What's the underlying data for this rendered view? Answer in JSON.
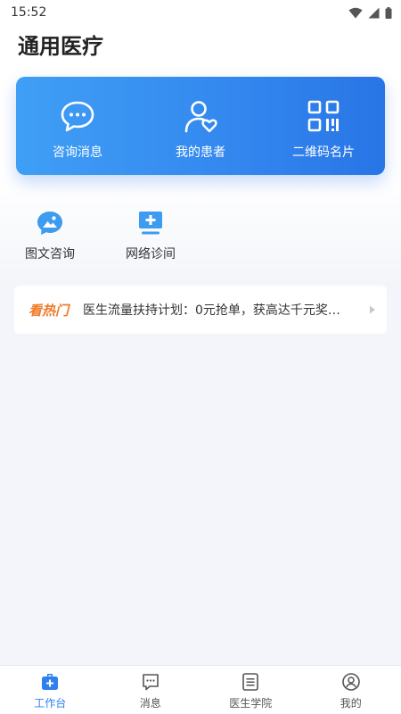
{
  "status_bar": {
    "time": "15:52"
  },
  "app": {
    "title": "通用医疗"
  },
  "quick_actions": [
    {
      "label": "咨询消息",
      "icon": "chat-bubble-icon"
    },
    {
      "label": "我的患者",
      "icon": "patient-heart-icon"
    },
    {
      "label": "二维码名片",
      "icon": "qr-code-icon"
    }
  ],
  "services": [
    {
      "label": "图文咨询",
      "icon": "image-chat-icon"
    },
    {
      "label": "网络诊间",
      "icon": "monitor-plus-icon"
    }
  ],
  "hot": {
    "tag": "看热门",
    "text": "医生流量扶持计划：0元抢单，获高达千元奖…"
  },
  "tabs": [
    {
      "label": "工作台",
      "icon": "medical-bag-icon",
      "active": true
    },
    {
      "label": "消息",
      "icon": "message-icon",
      "active": false
    },
    {
      "label": "医生学院",
      "icon": "document-list-icon",
      "active": false
    },
    {
      "label": "我的",
      "icon": "user-circle-icon",
      "active": false
    }
  ],
  "colors": {
    "accent": "#2f80ed",
    "card_gradient_start": "#3f9ff5",
    "card_gradient_end": "#2875e6",
    "hot_tag": "#f07a2a",
    "background": "#f3f5fa"
  }
}
